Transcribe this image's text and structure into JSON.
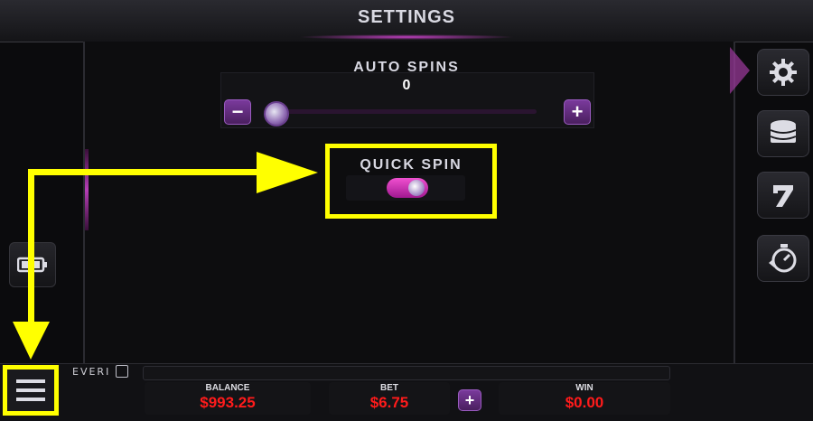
{
  "header": {
    "title": "SETTINGS"
  },
  "auto_spins": {
    "label": "AUTO SPINS",
    "value": "0",
    "minus_label": "−",
    "plus_label": "+",
    "slider_level": 0
  },
  "quick_spin": {
    "label": "QUICK SPIN",
    "enabled": true
  },
  "side_menu": {
    "icons": [
      "gear-icon",
      "coins-icon",
      "seven-icon",
      "stopwatch-icon"
    ]
  },
  "left_button": {
    "icon": "battery-icon"
  },
  "bottom_bar": {
    "brand": "EVERI",
    "balance": {
      "label": "BALANCE",
      "value": "$993.25"
    },
    "bet": {
      "label": "BET",
      "value": "$6.75",
      "plus_label": "+"
    },
    "win": {
      "label": "WIN",
      "value": "$0.00"
    }
  },
  "colors": {
    "accent_magenta": "#b63eb6",
    "highlight_yellow": "#ffff00",
    "money_red": "#ff1b1b"
  }
}
